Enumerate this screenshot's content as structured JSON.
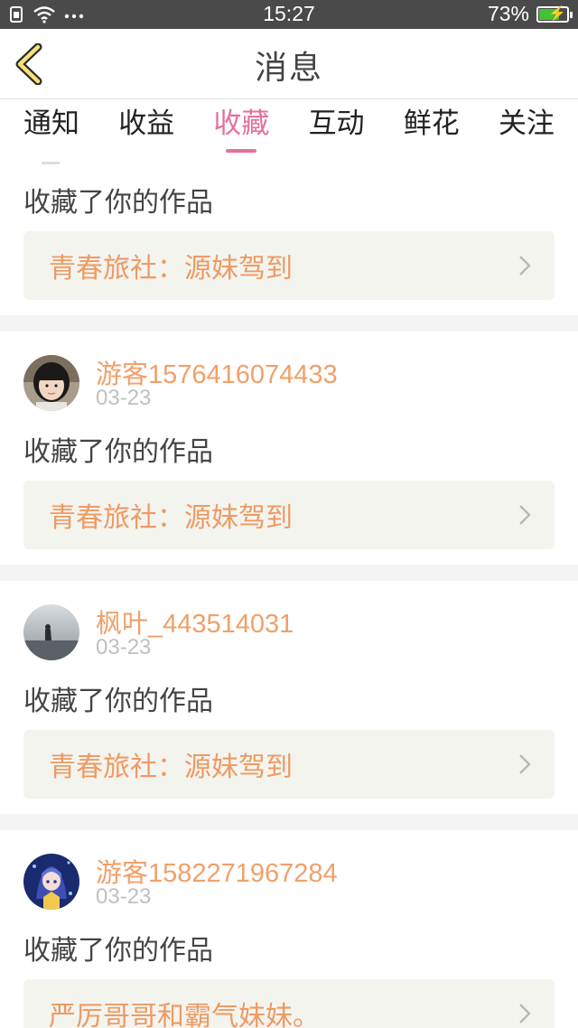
{
  "status_bar": {
    "time": "15:27",
    "battery": "73%",
    "battery_level": 0.73,
    "icons": [
      "sim-icon",
      "wifi-icon",
      "more-dots-icon",
      "battery-charging-icon"
    ]
  },
  "header": {
    "title": "消息",
    "back_icon": "chevron-left-icon"
  },
  "tabs": [
    {
      "label": "通知",
      "active": false
    },
    {
      "label": "收益",
      "active": false
    },
    {
      "label": "收藏",
      "active": true
    },
    {
      "label": "互动",
      "active": false
    },
    {
      "label": "鲜花",
      "active": false
    },
    {
      "label": "关注",
      "active": false
    }
  ],
  "colors": {
    "accent": "#e66f9d",
    "name": "#f0a06a",
    "work_title": "#ee9a62",
    "card_bg": "#f4f4ef"
  },
  "feed": {
    "partial_item": {
      "action": "收藏了你的作品",
      "work_title": "青春旅社：源妹驾到"
    },
    "items": [
      {
        "user_name": "游客1576416074433",
        "date": "03-23",
        "action": "收藏了你的作品",
        "work_title": "青春旅社：源妹驾到",
        "avatar": "avatar-girl"
      },
      {
        "user_name": "枫叶_443514031",
        "date": "03-23",
        "action": "收藏了你的作品",
        "work_title": "青春旅社：源妹驾到",
        "avatar": "avatar-landscape"
      },
      {
        "user_name": "游客1582271967284",
        "date": "03-23",
        "action": "收藏了你的作品",
        "work_title": "严厉哥哥和霸气妹妹。",
        "avatar": "avatar-anime"
      }
    ]
  }
}
